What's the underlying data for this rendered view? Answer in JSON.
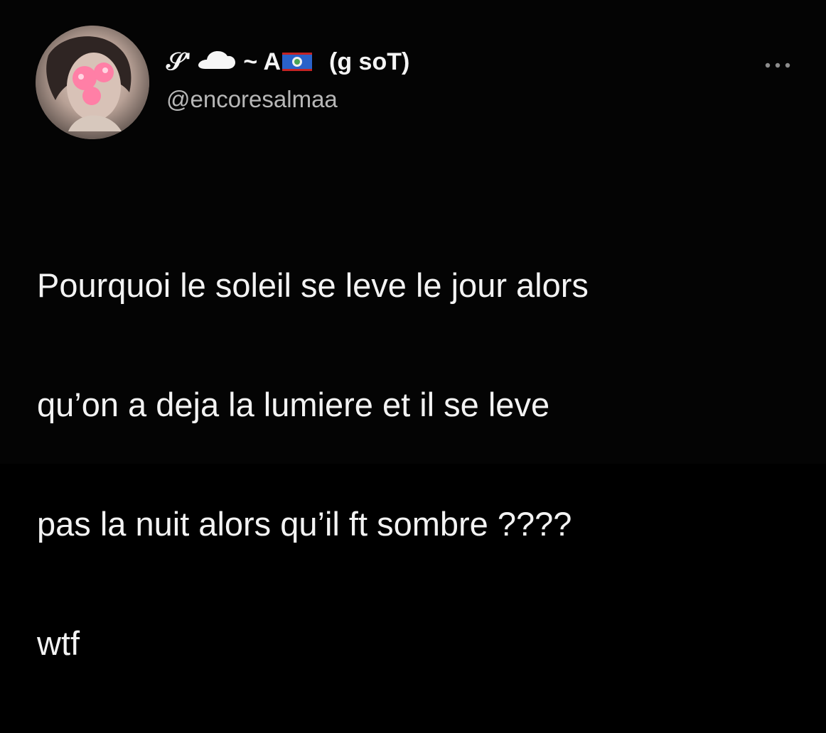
{
  "user": {
    "display_name_prefix": "𝒮'",
    "display_name_middle": "~ A",
    "display_name_suffix": "(g soT)",
    "handle": "@encoresalmaa"
  },
  "tweet": {
    "lines": [
      "Pourquoi le soleil se leve le jour alors",
      "qu’on a deja la lumiere et il se leve",
      "pas la nuit alors qu’il ft sombre ????",
      "wtf"
    ]
  },
  "icons": {
    "avatar": "avatar-icon",
    "cloud": "cloud-icon",
    "flag": "flag-icon",
    "more": "more-options-icon"
  },
  "colors": {
    "background": "#040404",
    "primary_text": "#f3f3f3",
    "secondary_text": "#b7b7b7",
    "flag_blue": "#2a62c9",
    "flag_red": "#c52323"
  }
}
